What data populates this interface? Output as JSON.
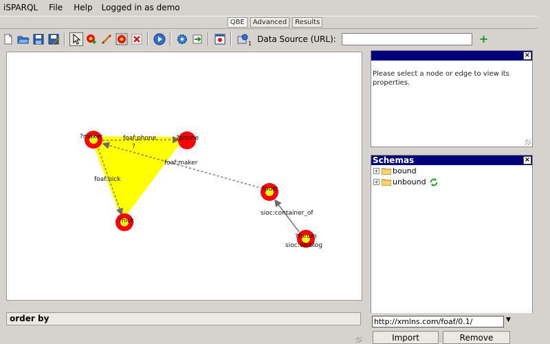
{
  "menubar": {
    "brand": "iSPARQL",
    "items": [
      "File",
      "Help"
    ],
    "status": "Logged in as demo"
  },
  "tabs": [
    {
      "label": "QBE",
      "active": true
    },
    {
      "label": "Advanced",
      "active": false
    },
    {
      "label": "Results",
      "active": false
    }
  ],
  "toolbar": {
    "icons": [
      "new-icon",
      "open-icon",
      "save-icon",
      "save-as-icon",
      "select-icon",
      "add-node-icon",
      "draw-edge-icon",
      "add-group-icon",
      "delete-icon",
      "run-icon",
      "generate-icon",
      "load-icon",
      "options-icon",
      "dataset-icon"
    ],
    "dataset_badge": "1",
    "datasource_label": "Data Source (URL):",
    "datasource_value": "",
    "add_icon": "+"
  },
  "graph": {
    "nodes": [
      {
        "label": "?maker"
      },
      {
        "label": "?phone"
      },
      {
        "label": "?nick"
      },
      {
        "label": "?post"
      },
      {
        "label": "?forum"
      }
    ],
    "edges": [
      {
        "label": "foaf:phone",
        "sub_label": "?"
      },
      {
        "label": "foaf:nick"
      },
      {
        "label": "foaf:maker"
      },
      {
        "label": "sioc:container_of"
      },
      {
        "label": "sioc:Weblog"
      }
    ],
    "group_color": "#ffff00",
    "node_color": "#ff0000"
  },
  "order_by": {
    "label": "order by"
  },
  "properties_panel": {
    "message": "Please select a node or edge to view its properties.",
    "close": "×"
  },
  "schemas_panel": {
    "title": "Schemas",
    "close": "×",
    "items": [
      {
        "label": "bound",
        "expander": "+"
      },
      {
        "label": "unbound",
        "expander": "+"
      }
    ],
    "url_value": "http://xmlns.com/foaf/0.1/",
    "import_label": "Import",
    "remove_label": "Remove"
  }
}
